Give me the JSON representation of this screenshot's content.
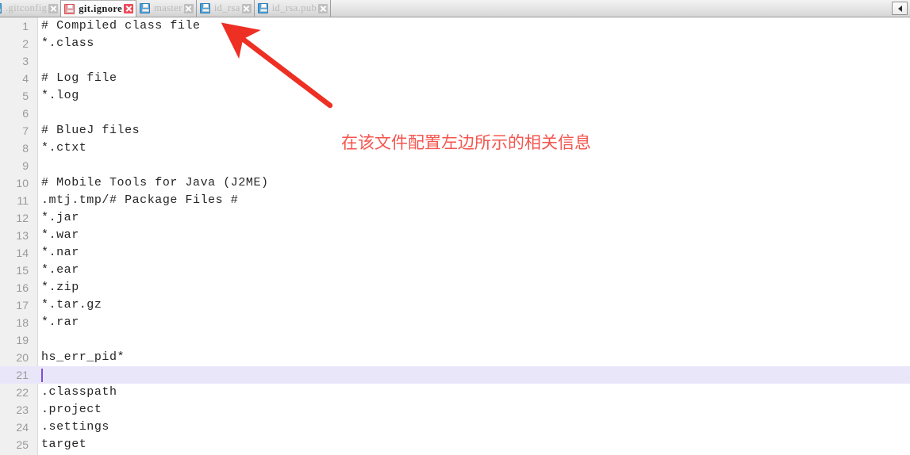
{
  "tabbar": {
    "scroll_left_label": "◀",
    "tabs": [
      {
        "label": ".gitconfig",
        "icon": "save-disk-icon",
        "icon_color": "#4da3dd",
        "close_icon": "close-icon",
        "active": false,
        "partially_clipped": true
      },
      {
        "label": "git.ignore",
        "icon": "save-disk-icon",
        "icon_color": "#ef8f94",
        "close_icon": "close-icon",
        "active": true,
        "partially_clipped": false
      },
      {
        "label": "master",
        "icon": "save-disk-icon",
        "icon_color": "#4da3dd",
        "close_icon": "close-icon",
        "active": false,
        "partially_clipped": false
      },
      {
        "label": "id_rsa",
        "icon": "save-disk-icon",
        "icon_color": "#4da3dd",
        "close_icon": "close-icon",
        "active": false,
        "partially_clipped": false
      },
      {
        "label": "id_rsa.pub",
        "icon": "save-disk-icon",
        "icon_color": "#4da3dd",
        "close_icon": "close-icon",
        "active": false,
        "partially_clipped": false
      }
    ]
  },
  "editor": {
    "current_line": 21,
    "current_line_highlight_color": "#e9e6fa",
    "caret_color": "#7b4fd4",
    "gutter_color": "#f0f0f0",
    "line_number_color": "#9a9a9a",
    "text_color": "#262626",
    "lines": [
      {
        "n": "1",
        "text": "# Compiled class file"
      },
      {
        "n": "2",
        "text": "*.class"
      },
      {
        "n": "3",
        "text": ""
      },
      {
        "n": "4",
        "text": "# Log file"
      },
      {
        "n": "5",
        "text": "*.log"
      },
      {
        "n": "6",
        "text": ""
      },
      {
        "n": "7",
        "text": "# BlueJ files"
      },
      {
        "n": "8",
        "text": "*.ctxt"
      },
      {
        "n": "9",
        "text": ""
      },
      {
        "n": "10",
        "text": "# Mobile Tools for Java (J2ME)"
      },
      {
        "n": "11",
        "text": ".mtj.tmp/# Package Files #"
      },
      {
        "n": "12",
        "text": "*.jar"
      },
      {
        "n": "13",
        "text": "*.war"
      },
      {
        "n": "14",
        "text": "*.nar"
      },
      {
        "n": "15",
        "text": "*.ear"
      },
      {
        "n": "16",
        "text": "*.zip"
      },
      {
        "n": "17",
        "text": "*.tar.gz"
      },
      {
        "n": "18",
        "text": "*.rar"
      },
      {
        "n": "19",
        "text": ""
      },
      {
        "n": "20",
        "text": "hs_err_pid*"
      },
      {
        "n": "21",
        "text": ""
      },
      {
        "n": "22",
        "text": ".classpath"
      },
      {
        "n": "23",
        "text": ".project"
      },
      {
        "n": "24",
        "text": ".settings"
      },
      {
        "n": "25",
        "text": "target"
      }
    ]
  },
  "annotation": {
    "text": "在该文件配置左边所示的相关信息",
    "color": "#f4554e",
    "arrow_color": "#ee2f24"
  }
}
